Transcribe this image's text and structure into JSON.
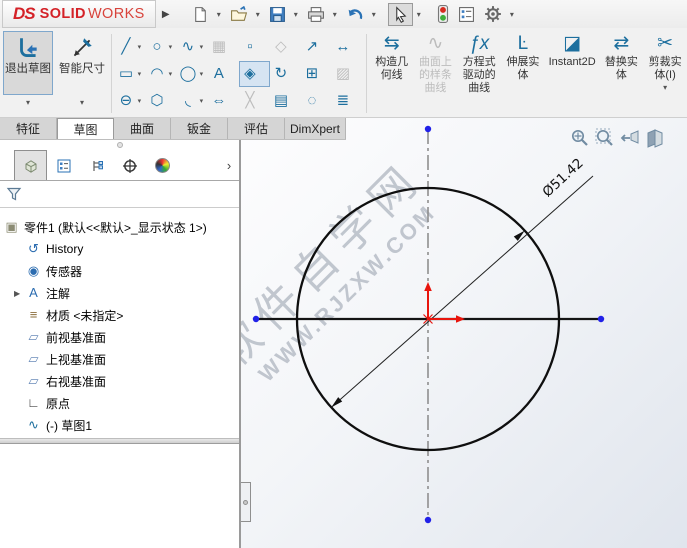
{
  "icons": {
    "dropdown": "▾",
    "flyout": "▶",
    "expand": "▶",
    "panel_more": "›",
    "exit_sketch": "exit-sketch-icon",
    "smart_dimension": "smart-dimension-icon"
  },
  "titlebar": {
    "logo_mark": "DS",
    "logo_bold": "SOLID",
    "logo_light": "WORKS",
    "tools": [
      "new-document",
      "open",
      "save",
      "print",
      "undo",
      "select",
      "rebuild-traffic-light",
      "options-list",
      "options-gear"
    ]
  },
  "command_tabs": [
    {
      "label": "特征"
    },
    {
      "label": "草图",
      "state": "active"
    },
    {
      "label": "曲面"
    },
    {
      "label": "钣金"
    },
    {
      "label": "评估"
    },
    {
      "label": "DimXpert"
    }
  ],
  "ribbon": {
    "exit_sketch": {
      "label": "退出草图",
      "state": "active"
    },
    "smart_dimension": {
      "label": "智能尺寸"
    },
    "sketch_tools_row1": [
      {
        "name": "line-tool",
        "glyph": "╱",
        "dropdown": true
      },
      {
        "name": "circle-tool",
        "glyph": "○",
        "dropdown": true
      },
      {
        "name": "spline-tool",
        "glyph": "∿",
        "dropdown": true
      },
      {
        "name": "mesh-tool",
        "glyph": "▦",
        "state": "disabled"
      },
      {
        "name": "point-tool",
        "glyph": "▫"
      },
      {
        "name": "mirror-entities-tool",
        "glyph": "◇",
        "state": "disabled"
      },
      {
        "name": "linear-sketch-pattern-tool",
        "glyph": "↗"
      },
      {
        "name": "move-entities-tool",
        "glyph": "↔"
      }
    ],
    "sketch_tools_row2": [
      {
        "name": "rectangle-tool",
        "glyph": "▭",
        "dropdown": true
      },
      {
        "name": "arc-tool",
        "glyph": "◠",
        "dropdown": true
      },
      {
        "name": "ellipse-tool",
        "glyph": "◯",
        "dropdown": true
      },
      {
        "name": "sketch-text-tool",
        "glyph": "A"
      },
      {
        "name": "sketch-ink-dimension-tool",
        "glyph": "◈",
        "state": "active"
      },
      {
        "name": "rotate-entities-tool",
        "glyph": "↻"
      },
      {
        "name": "make-block-tool",
        "glyph": "⊞"
      },
      {
        "name": "surface-spline-tool",
        "glyph": "▨",
        "state": "disabled"
      }
    ],
    "sketch_tools_row3": [
      {
        "name": "slot-tool",
        "glyph": "⊖",
        "dropdown": true
      },
      {
        "name": "polygon-tool",
        "glyph": "⬡"
      },
      {
        "name": "fillet-tool",
        "glyph": "◟",
        "dropdown": true
      },
      {
        "name": "stretch-entities-tool",
        "glyph": "⇔"
      },
      {
        "name": "trim-entities-small-tool",
        "glyph": "╳",
        "state": "disabled"
      },
      {
        "name": "sketch-picture-tool",
        "glyph": "▤"
      },
      {
        "name": "blob-tool",
        "glyph": "◌"
      },
      {
        "name": "layers-tool",
        "glyph": "≣"
      }
    ],
    "big_tools": [
      {
        "name": "construction-geometry",
        "label": "构造几何线",
        "glyph": "⇆"
      },
      {
        "name": "spline-on-surface",
        "label": "曲面上的样条曲线",
        "glyph": "∿",
        "state": "disabled"
      },
      {
        "name": "equation-driven-curve",
        "label": "方程式驱动的曲线",
        "glyph": "ƒx"
      },
      {
        "name": "stretch-entities",
        "label": "伸展实体",
        "glyph": "Ŀ"
      },
      {
        "name": "instant2d",
        "label": "Instant2D",
        "glyph": "◪"
      },
      {
        "name": "replace-entity",
        "label": "替换实体",
        "glyph": "⇄"
      },
      {
        "name": "trim-entities",
        "label": "剪裁实体(I)",
        "glyph": "✂",
        "dropdown": true
      }
    ]
  },
  "panel": {
    "tree_root": "零件1 (默认<<默认>_显示状态 1>)",
    "tree_items": [
      {
        "label": "History",
        "glyph": "↺",
        "color": "#2b6cb0"
      },
      {
        "label": "传感器",
        "glyph": "◉",
        "color": "#2b6cb0"
      },
      {
        "label": "注解",
        "glyph": "A",
        "color": "#2b6cb0",
        "expand": true
      },
      {
        "label": "材质 <未指定>",
        "glyph": "≡",
        "color": "#8a6d3b"
      },
      {
        "label": "前视基准面",
        "glyph": "▱",
        "color": "#6b8cba"
      },
      {
        "label": "上视基准面",
        "glyph": "▱",
        "color": "#6b8cba"
      },
      {
        "label": "右视基准面",
        "glyph": "▱",
        "color": "#6b8cba"
      },
      {
        "label": "原点",
        "glyph": "∟",
        "color": "#444444"
      },
      {
        "label": "(-) 草图1",
        "glyph": "∿",
        "color": "#1d6f9e"
      }
    ]
  },
  "viewport": {
    "dimension_label": "Ø51.42",
    "watermark_line1": "软件自学网",
    "watermark_line2": "WWW.RJZXW.COM",
    "sketch_color": "#111111",
    "centerline_color": "#8f8f8f",
    "endpoint_color": "#2121e8",
    "origin_color": "#e8150d"
  }
}
